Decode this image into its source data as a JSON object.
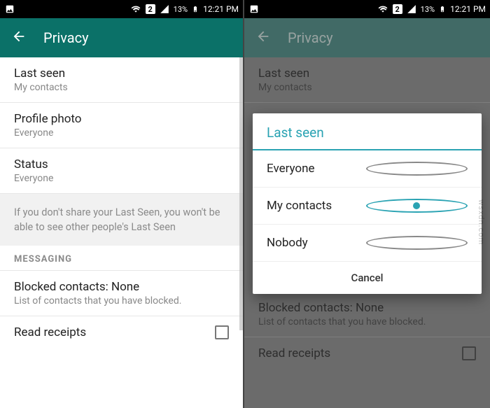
{
  "statusbar": {
    "sim": "2",
    "battery_pct": "13%",
    "time": "12:21 PM"
  },
  "appbar": {
    "title": "Privacy"
  },
  "left": {
    "last_seen": {
      "label": "Last seen",
      "value": "My contacts"
    },
    "profile_photo": {
      "label": "Profile photo",
      "value": "Everyone"
    },
    "status": {
      "label": "Status",
      "value": "Everyone"
    },
    "note": "If you don't share your Last Seen, you won't be able to see other people's Last Seen",
    "section_messaging": "MESSAGING",
    "blocked": {
      "label": "Blocked contacts: None",
      "sub": "List of contacts that you have blocked."
    },
    "read_receipts": {
      "label": "Read receipts"
    }
  },
  "right": {
    "last_seen": {
      "label": "Last seen",
      "value": "My contacts"
    },
    "blocked": {
      "label": "Blocked contacts: None",
      "sub": "List of contacts that you have blocked."
    },
    "read_receipts": {
      "label": "Read receipts"
    }
  },
  "dialog": {
    "title": "Last seen",
    "options": {
      "o0": "Everyone",
      "o1": "My contacts",
      "o2": "Nobody"
    },
    "selected": "o1",
    "cancel": "Cancel"
  },
  "watermark": "wsxdn.com"
}
